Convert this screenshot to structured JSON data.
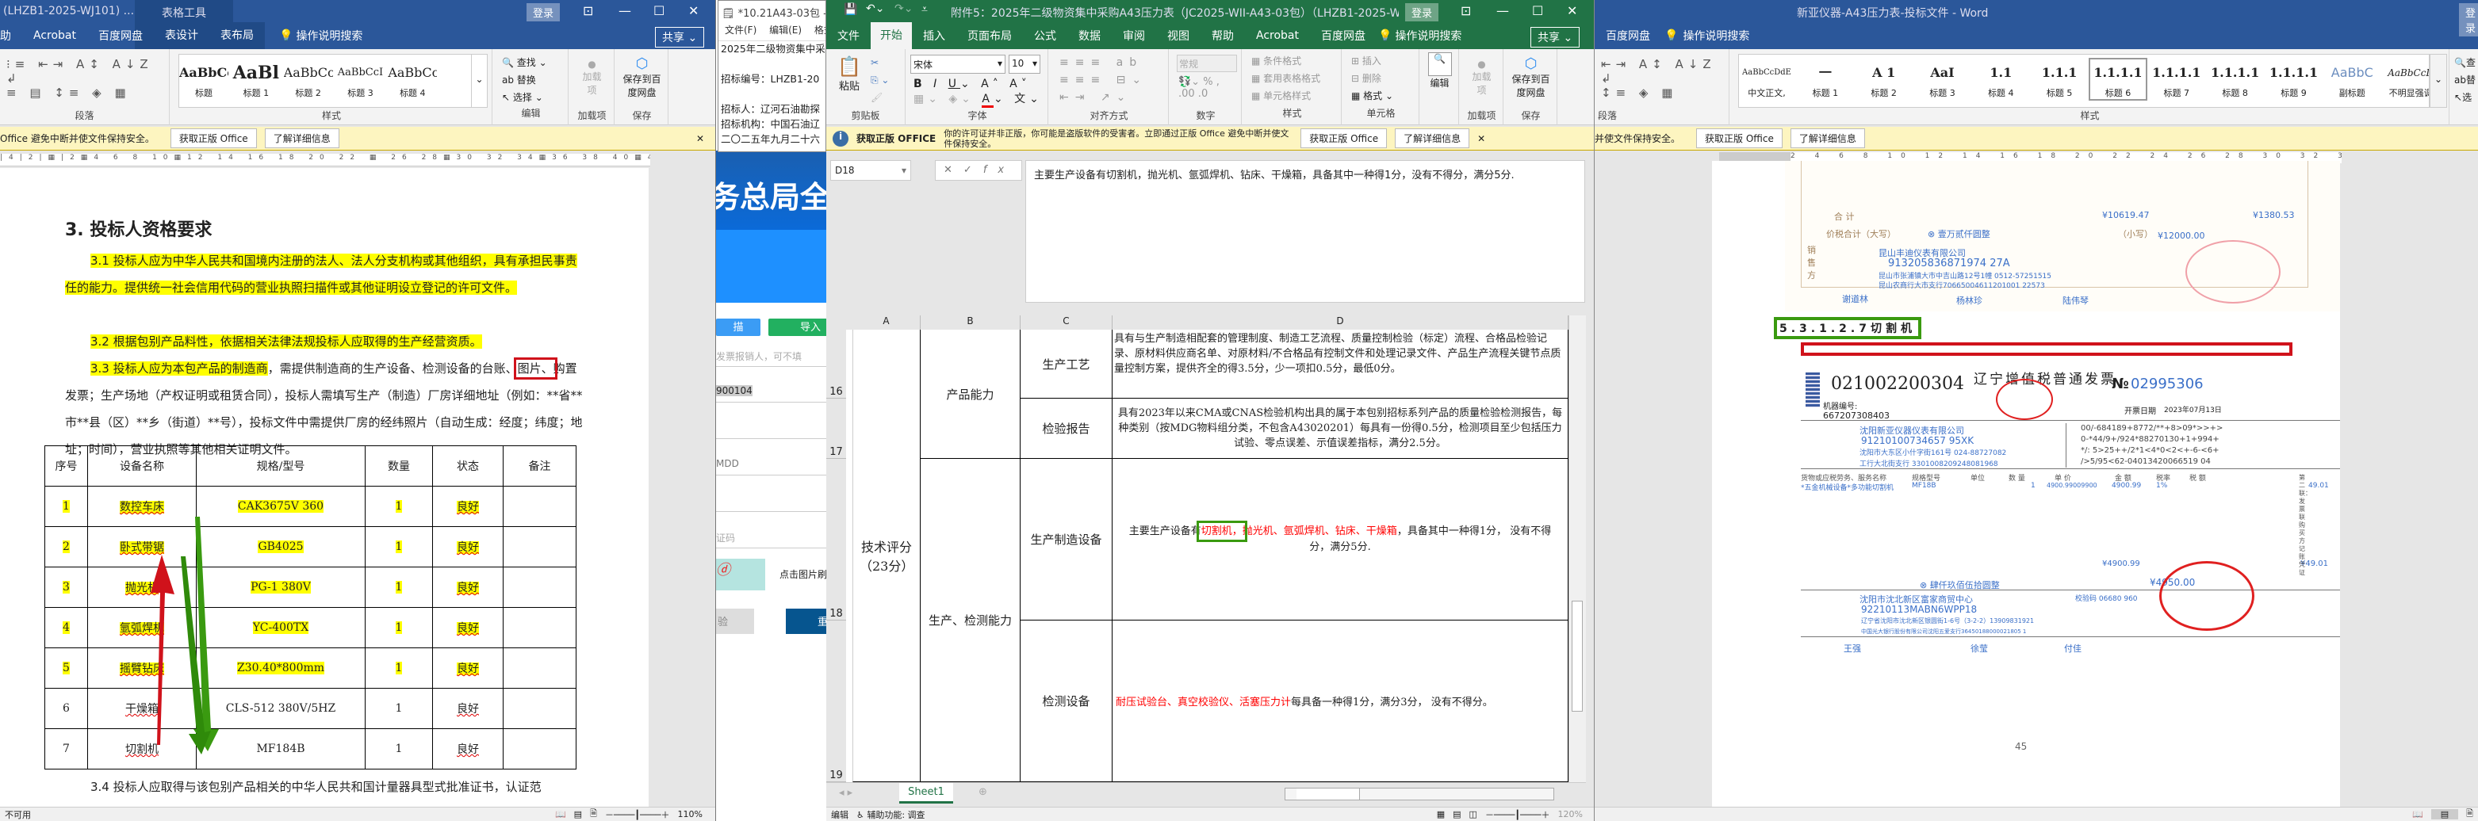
{
  "left_word": {
    "title": "(LHZB1-2025-WJ101) ...",
    "context_tab": "表格工具",
    "login": "登录",
    "tabs": [
      "助",
      "Acrobat",
      "百度网盘",
      "表设计",
      "表布局"
    ],
    "search": "操作说明搜索",
    "share": "共享",
    "groups": {
      "paragraph": "段落",
      "styles": "样式",
      "edit": "编辑",
      "addins": "加载项",
      "save": "保存"
    },
    "styles": [
      {
        "preview": "AaBbCc",
        "label": "标题"
      },
      {
        "preview": "AaBl",
        "label": "标题 1"
      },
      {
        "preview": "AaBbCc",
        "label": "标题 2"
      },
      {
        "preview": "AaBbCcI",
        "label": "标题 3"
      },
      {
        "preview": "AaBbCc",
        "label": "标题 4"
      }
    ],
    "edit_items": [
      "查找",
      "替换",
      "选择"
    ],
    "addin_btn": "加载项",
    "save_btn": "保存到百度网盘",
    "notice": "Office 避免中断并使文件保持安全。",
    "get_office": "获取正版 Office",
    "learn_more": "了解详细信息",
    "doc": {
      "heading": "3. 投标人资格要求",
      "p31": "3.1 投标人应为中华人民共和国境内注册的法人、法人分支机构或其他组织，具有承担民事责任的能力。提供统一社会信用代码的营业执照扫描件或其他证明设立登记的许可文件。",
      "p32": "3.2 根据包别产品料性，依据相关法律法规投标人应取得的生产经营资质。",
      "p33_hl": "3.3 投标人应为本包产品的制造商",
      "p33_a": "，需提供制造商的生产设备、检测设备的台账、",
      "p33_box": "图片、",
      "p33_b": "购置发票；生产场地（产权证明或租赁合同），投标人需填写生产（制造）厂房详细地址（例如：**省**市**县（区）**乡（街道）**号），投标文件中需提供厂房的经纬照片（自动生成：经度；纬度；地址；时间），营业执照等其他相关证明文件。",
      "p34": "3.4 投标人应取得与该包别产品相关的中华人民共和国计量器具型式批准证书，认证范",
      "table": {
        "headers": [
          "序号",
          "设备名称",
          "规格/型号",
          "数量",
          "状态",
          "备注"
        ],
        "rows": [
          [
            "1",
            "数控车床",
            "CAK3675V 360",
            "1",
            "良好",
            ""
          ],
          [
            "2",
            "卧式带锯",
            "GB4025",
            "1",
            "良好",
            ""
          ],
          [
            "3",
            "抛光机",
            "PG-1 380V",
            "1",
            "良好",
            ""
          ],
          [
            "4",
            "氩弧焊机",
            "YC-400TX",
            "1",
            "良好",
            ""
          ],
          [
            "5",
            "摇臂钻床",
            "Z30.40*800mm",
            "1",
            "良好",
            ""
          ],
          [
            "6",
            "干燥箱",
            "CLS-512 380V/5HZ",
            "1",
            "良好",
            ""
          ],
          [
            "7",
            "切割机",
            "MF184B",
            "1",
            "良好",
            ""
          ]
        ]
      }
    },
    "status_left": "不可用",
    "zoom": "110%"
  },
  "notepad": {
    "title": "*10.21A43-03包 - 记",
    "menu": [
      "文件(F)",
      "编辑(E)",
      "格式"
    ],
    "lines": [
      "2025年二级物资集中采",
      "",
      "招标编号：LHZB1-20",
      "",
      "招标人：辽河石油勘探",
      "招标机构：中国石油辽",
      "二〇二五年九月二十六"
    ]
  },
  "browser": {
    "banner": "务总局全",
    "scan_btn": "描",
    "import_btn": "导入",
    "reimburser_placeholder": "发票报销人，可不填",
    "field_value": "900104",
    "date_placeholder": "MDD",
    "captcha_placeholder": "证码",
    "refresh_hint": "点击图片刷",
    "check_btn": "验",
    "reset_btn": "重"
  },
  "excel": {
    "title": "附件5：2025年二级物资集中采购A43压力表（JC2025-WII-A43-03包）（LHZB1-2025-WJ101）...",
    "login": "登录",
    "tabs": [
      "文件",
      "开始",
      "插入",
      "页面布局",
      "公式",
      "数据",
      "审阅",
      "视图",
      "帮助",
      "Acrobat",
      "百度网盘"
    ],
    "active_tab": "开始",
    "search": "操作说明搜索",
    "share": "共享",
    "paste": "粘贴",
    "font_name": "宋体",
    "font_size": "10",
    "number_format": "常规",
    "style_items": [
      "条件格式",
      "套用表格格式",
      "单元格样式"
    ],
    "cell_items": [
      "插入",
      "删除",
      "格式"
    ],
    "edit_btn": "编辑",
    "addin_btn": "加载项",
    "save_btn": "保存到百度网盘",
    "groups": [
      "剪贴板",
      "字体",
      "对齐方式",
      "数字",
      "样式",
      "单元格",
      "加载项",
      "保存"
    ],
    "notice_title": "获取正版 OFFICE",
    "notice": "你的许可证并非正版，你可能是盗版软件的受害者。立即通过正版 Office 避免中断并使文件保持安全。",
    "get_office": "获取正版 Office",
    "learn_more": "了解详细信息",
    "name_box": "D18",
    "formula": "主要生产设备有切割机，抛光机、氩弧焊机、钻床、干燥箱，具备其中一种得1分，没有不得分，满分5分.",
    "columns": [
      "A",
      "B",
      "C",
      "D"
    ],
    "rows": [
      "16",
      "17",
      "18",
      "19"
    ],
    "cells": {
      "a_merged": "技术评分（23分）",
      "b16": "产品能力",
      "b18": "生产、检测能力",
      "c16": "生产工艺",
      "d16": "具有与生产制造相配套的管理制度、制造工艺流程、质量控制检验（标定）流程、合格品检验记录、原材料供应商名单、对原材料/不合格品有控制文件和处理记录文件、产品生产流程关键节点质量控制方案，提供齐全的得3.5分，少一项扣0.5分，最低0分。",
      "c17": "检验报告",
      "d17": "具有2023年以来CMA或CNAS检验机构出具的属于本包别招标系列产品的质量检验检测报告，每种类别（按MDG物料组分类，不包含A43020201）每具有一份得0.5分，检测项目至少包括压力试验、零点误差、示值误差指标，满分2.5分。",
      "c18": "生产制造设备",
      "d18_a": "主要生产设备有",
      "d18_red1": "切割机，",
      "d18_red2": "抛光机、氩弧焊机、钻床、干燥箱",
      "d18_b": "，具备其中一种得1分，  没有不得分，满分5分.",
      "c19": "检测设备",
      "d19_red": "耐压试验台、真空校验仪、活塞压力计",
      "d19_b": "每具备一种得1分，满分3分，  没有不得分。"
    },
    "sheet_tab": "Sheet1",
    "status_mode": "编辑",
    "status_access": "辅助功能: 调查",
    "zoom": "120%"
  },
  "right_word": {
    "title": "新亚仪器-A43压力表-投标文件  -  Word",
    "login": "登录",
    "tabs": [
      "百度网盘"
    ],
    "search": "操作说明搜索",
    "groups": {
      "paragraph": "段落",
      "styles": "样式"
    },
    "styles": [
      {
        "preview": "AaBbCcDdE",
        "label": "中文正文,"
      },
      {
        "preview": "一",
        "label": "标题 1"
      },
      {
        "preview": "A 1",
        "label": "标题 2"
      },
      {
        "preview": "AaI",
        "label": "标题 3"
      },
      {
        "preview": "1.1",
        "label": "标题 4"
      },
      {
        "preview": "1.1.1",
        "label": "标题 5"
      },
      {
        "preview": "1.1.1.1",
        "label": "标题 6"
      },
      {
        "preview": "1.1.1.1",
        "label": "标题 7"
      },
      {
        "preview": "1.1.1.1",
        "label": "标题 8"
      },
      {
        "preview": "1.1.1.1",
        "label": "标题 9"
      },
      {
        "preview": "AaBbC",
        "label": "副标题"
      },
      {
        "preview": "AaBbCcD",
        "label": "不明显强调"
      }
    ],
    "edit_items": [
      "查",
      "替",
      "选"
    ],
    "notice": "并使文件保持安全。",
    "get_office": "获取正版 Office",
    "learn_more": "了解详细信息",
    "heading_box": "5.3.1.2.7切割机",
    "page_number": "45",
    "invoice1": {
      "seller_side": "销售方",
      "total_label": "合    计",
      "tax_total_label": "价税合计（大写）",
      "amount": "¥10619.47",
      "tax": "¥1380.53",
      "total_words": "⊗ 壹万贰仟圆整",
      "total_small_label": "（小写）",
      "total": "¥12000.00",
      "seller_name": "昆山丰迪仪表有限公司",
      "seller_tax_id": "913205836871974 27A",
      "seller_address": "昆山市张浦镇大市中吉山路12号1幢 0512-57251515",
      "seller_bank": "昆山农商行大市支行70665004611201001 22573",
      "payee": "谢道林",
      "reviewer": "杨林珍",
      "issuer": "陆伟琴"
    },
    "invoice2": {
      "code": "021002200304",
      "title": "辽宁增值税普通发票",
      "no_label": "№",
      "number": "02995306",
      "machine_label": "机器编号:",
      "machine_no": "667207308403",
      "date_label": "开票日期",
      "date": "2023年07月13日",
      "buyer_name": "沈阳新亚仪器仪表有限公司",
      "buyer_tax_id": "91210100734657 95XK",
      "buyer_address": "沈阳市大东区小什字街161号 024-88727082",
      "buyer_bank": "工行大北街支行 3301008209248081968",
      "cipher": [
        "00/-684189+8772/**+8>09*>>+>",
        "0-*44/9+/924*88270130+1+994+",
        "*/: 5>25++/2*1<4*0<2<+-6-<6+",
        "/>5/95<62-04013420066519 04"
      ],
      "item_headers": [
        "货物或应税劳务、服务名称",
        "规格型号",
        "单位",
        "数 量",
        "单 价",
        "金 额",
        "税率",
        "税 额"
      ],
      "item": [
        "*五金机械设备*多功能切割机",
        "MF18B",
        "",
        "1",
        "4900.99009900",
        "4900.99",
        "1%",
        "49.01"
      ],
      "subtotal": "¥4900.99",
      "subtax": "¥49.01",
      "total_words": "⊗ 肆仟玖佰伍拾圆整",
      "total": "¥4950.00",
      "seller_name": "沈阳市沈北新区富家商贸中心",
      "seller_tax_id": "92210113MABN6WPP18",
      "seller_address": "辽宁省沈阳市沈北新区银圆街1-6号（3-2-2）13909831921",
      "seller_bank": "中国光大银行股份有限公司沈阳五爱支行36450188000021805 1",
      "check_code": "校验码 06680 960",
      "payee": "王强",
      "reviewer": "徐莹",
      "issuer": "付佳",
      "side_note": "第二联：发票联 购买方记账凭证"
    }
  },
  "colors": {
    "word_blue": "#2b579a",
    "excel_green": "#217346",
    "highlight": "#ffff00",
    "annotation_red": "#d0121b",
    "annotation_green": "#3a9a10"
  }
}
